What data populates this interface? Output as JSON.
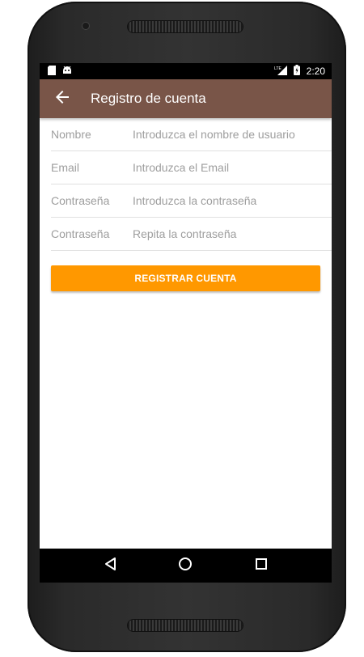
{
  "status_bar": {
    "network": "LTE",
    "time": "2:20"
  },
  "app_bar": {
    "title": "Registro de cuenta",
    "color": "#795548"
  },
  "form": {
    "fields": [
      {
        "label": "Nombre",
        "placeholder": "Introduzca el nombre de usuario"
      },
      {
        "label": "Email",
        "placeholder": "Introduzca el Email"
      },
      {
        "label": "Contraseña",
        "placeholder": "Introduzca la contraseña"
      },
      {
        "label": "Contraseña",
        "placeholder": "Repita la contraseña"
      }
    ],
    "submit_label": "REGISTRAR CUENTA",
    "submit_color": "#ff9800"
  },
  "icons": {
    "back": "arrow-left-icon",
    "sd_card": "sd-card-icon",
    "android": "android-icon",
    "signal": "signal-icon",
    "battery": "battery-icon",
    "nav_back": "triangle-back-icon",
    "nav_home": "circle-home-icon",
    "nav_recents": "square-recents-icon"
  }
}
